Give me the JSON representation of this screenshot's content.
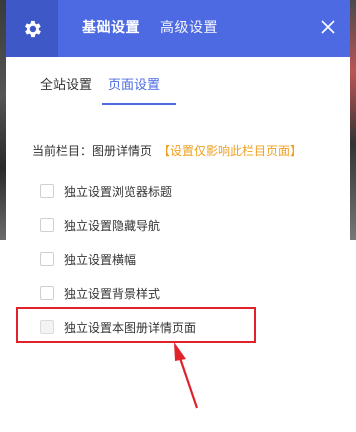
{
  "header": {
    "tabs": [
      {
        "label": "基础设置",
        "active": true
      },
      {
        "label": "高级设置",
        "active": false
      }
    ],
    "icons": {
      "settings": "gear-icon",
      "close": "close-icon"
    },
    "accent": "#4d6ae3"
  },
  "subtabs": [
    {
      "label": "全站设置",
      "active": false
    },
    {
      "label": "页面设置",
      "active": true
    }
  ],
  "current": {
    "label": "当前栏目：图册详情页",
    "note": "【设置仅影响此栏目页面】",
    "note_color": "#f0a020"
  },
  "options": [
    {
      "label": "独立设置浏览器标题",
      "checked": false
    },
    {
      "label": "独立设置隐藏导航",
      "checked": false
    },
    {
      "label": "独立设置横幅",
      "checked": false
    },
    {
      "label": "独立设置背景样式",
      "checked": false
    },
    {
      "label": "独立设置本图册详情页面",
      "checked": false,
      "highlighted": true
    }
  ],
  "annotation": {
    "color": "#e0222b"
  }
}
